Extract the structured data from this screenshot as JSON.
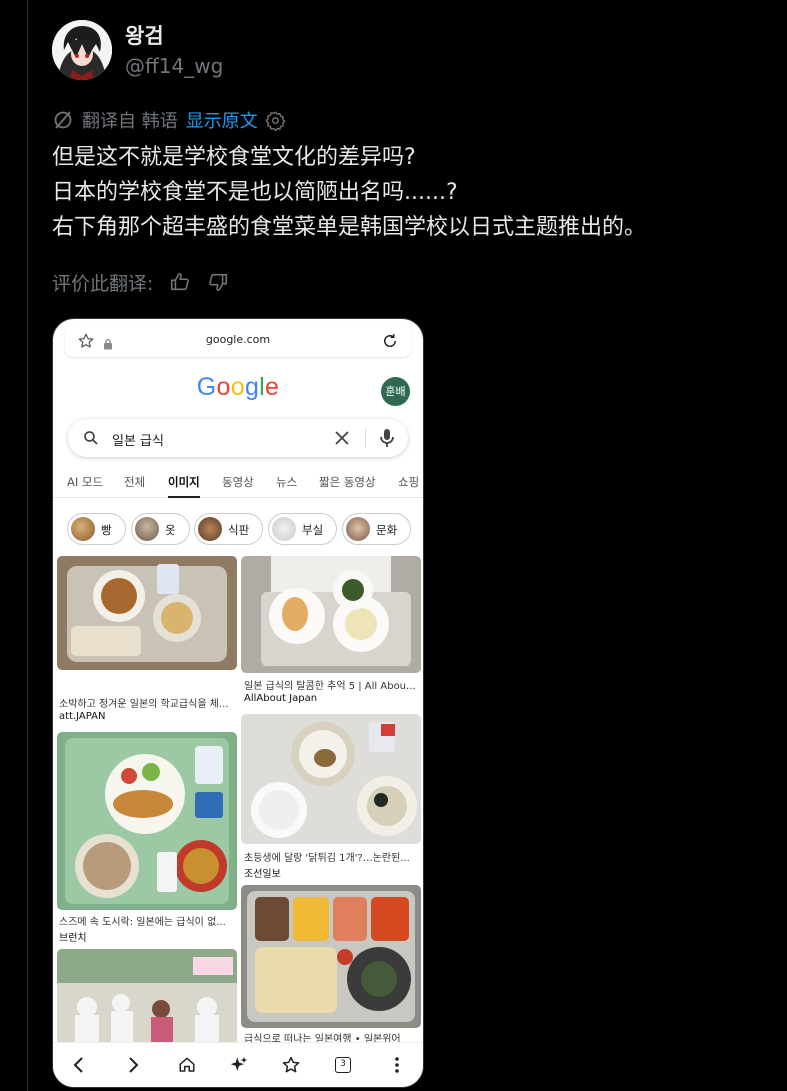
{
  "author": {
    "name": "왕검",
    "handle": "@ff14_wg"
  },
  "translation": {
    "label": "翻译自 韩语",
    "show_original": "显示原文"
  },
  "tweet": {
    "line1": "但是这不就是学校食堂文化的差异吗?",
    "line2": "日本的学校食堂不是也以简陋出名吗......?",
    "line3": "右下角那个超丰盛的食堂菜单是韩国学校以日式主题推出的。"
  },
  "rating": {
    "label": "评价此翻译:"
  },
  "phone": {
    "url": "google.com",
    "logo": "Google",
    "account": "훈배",
    "search_query": "일본 급식",
    "tabs": [
      "AI 모드",
      "전체",
      "이미지",
      "동영상",
      "뉴스",
      "짧은 동영상",
      "쇼핑"
    ],
    "active_tab": "이미지",
    "chips": [
      "빵",
      "옷",
      "식판",
      "부실",
      "문화"
    ],
    "results": [
      {
        "caption": "소박하고 정겨운 일본의 학교급식을 체...",
        "source": "att.JAPAN"
      },
      {
        "caption": "일본 급식의 탈콤한 추억 5 | All Abou...",
        "source": "AllAbout Japan"
      },
      {
        "caption": "스즈메 속 도시락: 일본에는 급식이 없...",
        "source": "브런치"
      },
      {
        "caption": "초등생에 달랑 '닭튀김 1개'?…논란된...",
        "source": "조선일보"
      },
      {
        "caption": "급식으로 떠나는 일본여행 • 일본위어",
        "source": ""
      }
    ],
    "nav_tab_count": "3"
  },
  "colors": {
    "background": "#000000",
    "accent": "#1d9bf0",
    "muted": "#71767b",
    "text": "#e7e9ea"
  }
}
